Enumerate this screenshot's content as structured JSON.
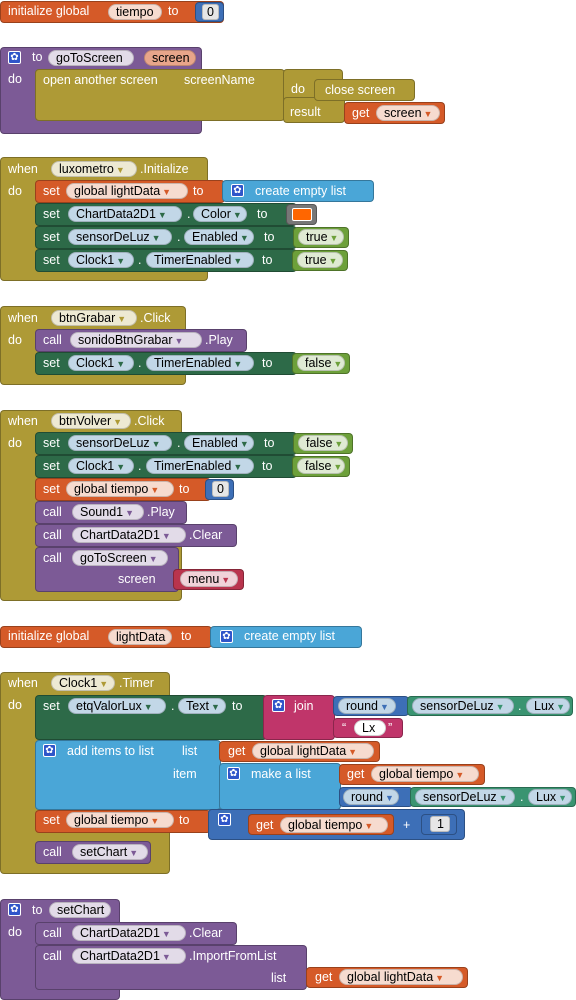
{
  "colors": {
    "orange": "#d55a28",
    "purple": "#7c5a96",
    "gold": "#ae9a36",
    "dark_green": "#2d6a48",
    "light_green": "#6da03a",
    "light_blue": "#4aa6d7",
    "math_blue": "#3d6fb7",
    "magenta": "#c0356a",
    "teal": "#3a9471",
    "color_swatch": "#ff6600"
  },
  "kw": {
    "initialize_global": "initialize global",
    "to": "to",
    "do": "do",
    "when": "when",
    "set": "set",
    "call": "call",
    "get": "get",
    "result": "result",
    "dot": ".",
    "join": "join",
    "plus": "+",
    "round": "round",
    "create_empty_list": "create empty list",
    "make_a_list": "make a list",
    "add_items_to_list": "add items to list",
    "list": "list",
    "item": "item",
    "open_another_screen": "open another screen",
    "screen_name": "screenName",
    "close_screen": "close screen",
    "screen": "screen",
    "true": "true",
    "false": "false",
    "initialize": ".Initialize",
    "click": ".Click",
    "timer": ".Timer",
    "play": ".Play",
    "clear": ".Clear",
    "import_from_list": ".ImportFromList",
    "global_tiempo": "global tiempo",
    "global_lightdata": "global lightData"
  },
  "icons": {
    "mutator": "gear-icon",
    "dropdown": "dropdown-triangle-icon"
  },
  "components": {
    "tiempo": "tiempo",
    "lightData": "lightData",
    "luxometro": "luxometro",
    "btnGrabar": "btnGrabar",
    "btnVolver": "btnVolver",
    "clock1": "Clock1",
    "chartData": "ChartData2D1",
    "sensor": "sensorDeLuz",
    "sound": "sonidoBtnGrabar",
    "sound1": "Sound1",
    "etq": "etqValorLux"
  },
  "props": {
    "color": "Color",
    "enabled": "Enabled",
    "timer_enabled": "TimerEnabled",
    "text": "Text",
    "lux": "Lux"
  },
  "procs": {
    "goToScreen": "goToScreen",
    "setChart": "setChart",
    "screen_param": "screen"
  },
  "values": {
    "zero": "0",
    "one": "1",
    "menu": "menu",
    "lx_string": "Lx"
  }
}
